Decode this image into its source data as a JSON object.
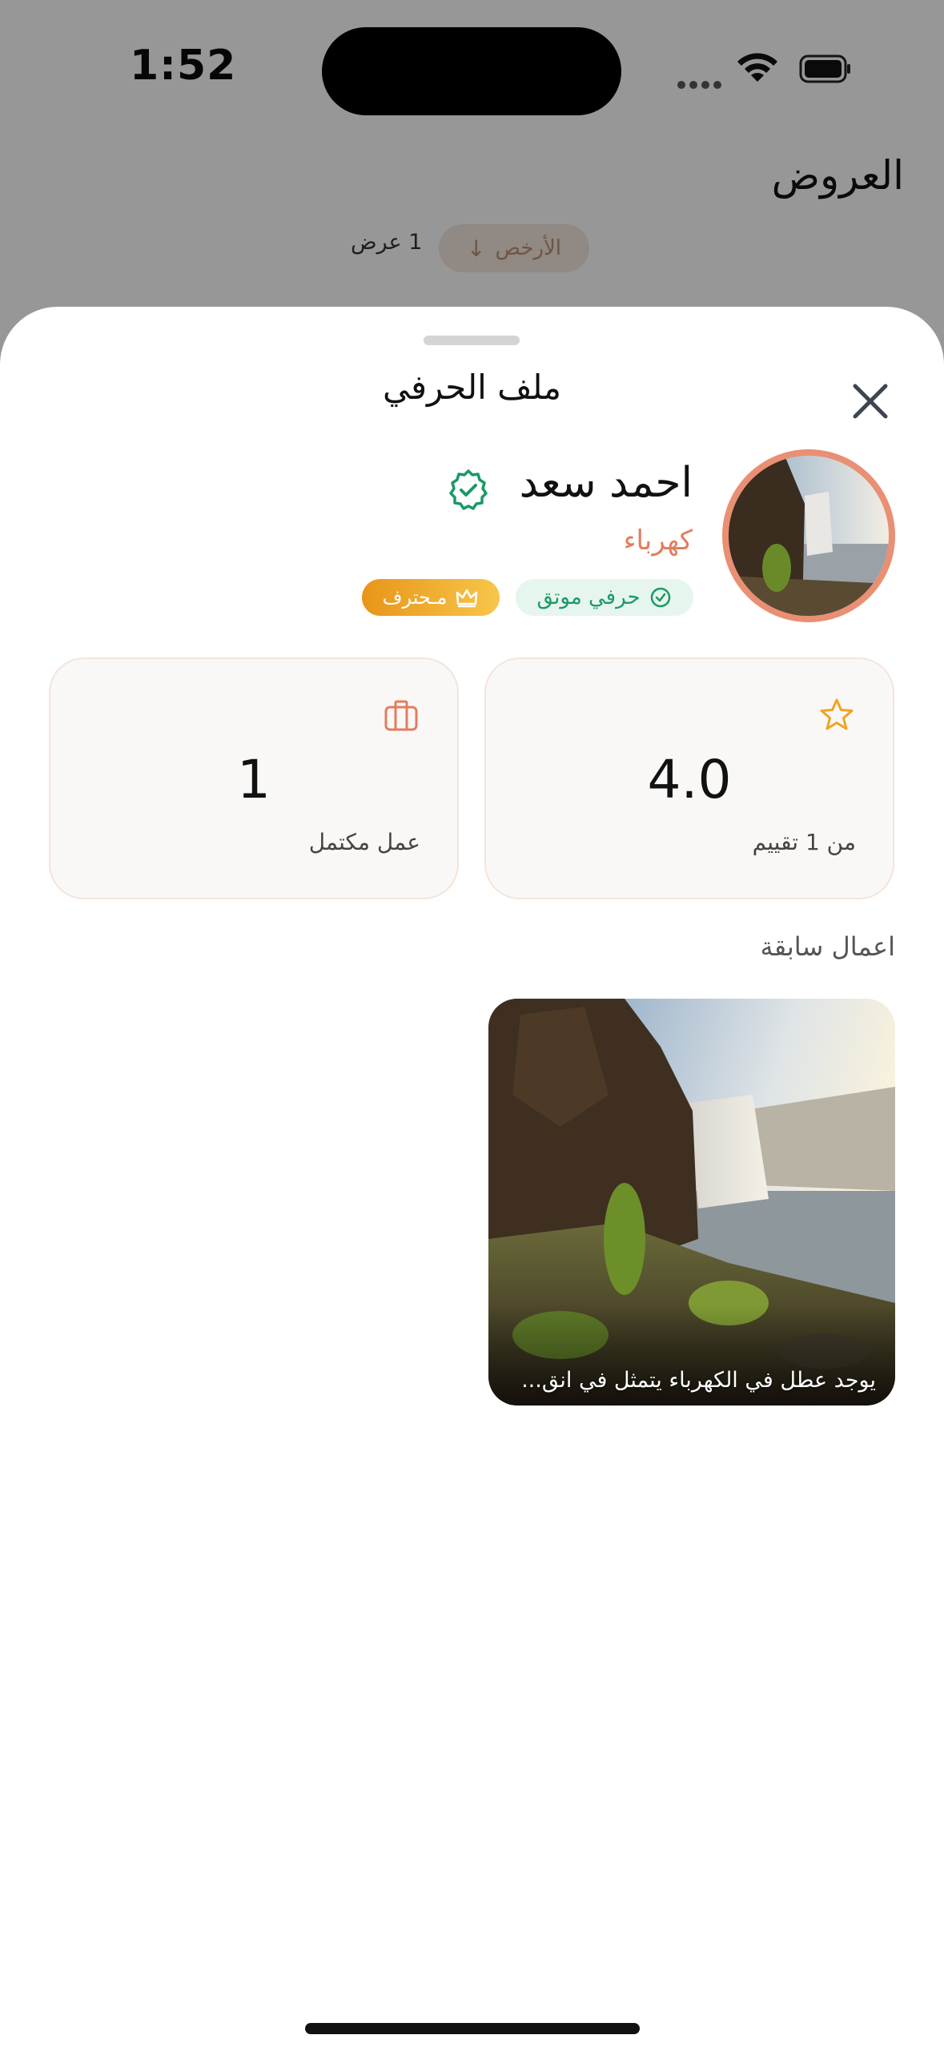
{
  "status_bar": {
    "time": "1:52"
  },
  "background": {
    "title": "العروض",
    "sort_label": "الأرخص",
    "sort_arrow": "↓",
    "offers_count": "1 عرض"
  },
  "sheet": {
    "title": "ملف الحرفي",
    "profile": {
      "name": "احمد سعد",
      "category": "كهرباء",
      "trusted_badge": "حرفي موتق",
      "pro_badge": "مـحترف"
    },
    "stats": {
      "rating_value": "4.0",
      "rating_caption": "من 1 تقييم",
      "jobs_value": "1",
      "jobs_caption": "عمل مكتمل"
    },
    "previous_works": {
      "title": "اعمال سابقة",
      "items": [
        {
          "caption": "يوجد عطل في الكهرباء يتمثل في انق..."
        }
      ]
    }
  },
  "colors": {
    "accent": "#e27d5f",
    "verified_green": "#1a9a66",
    "pro_gold": "#f0a324",
    "star": "#f0a324"
  },
  "icons": {
    "close": "close-icon",
    "verified": "verified-check-icon",
    "crown": "crown-icon",
    "star": "star-icon",
    "briefcase": "briefcase-icon"
  }
}
